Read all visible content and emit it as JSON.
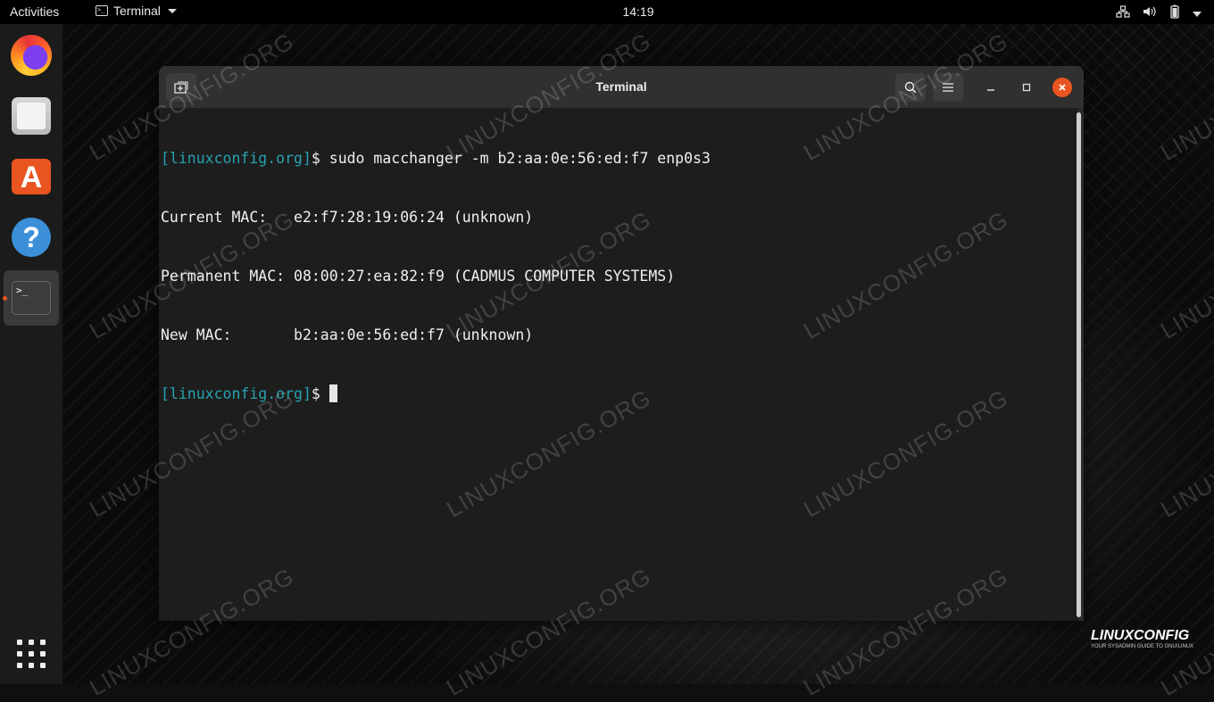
{
  "topbar": {
    "activities": "Activities",
    "app_name": "Terminal",
    "clock": "14:19"
  },
  "dock": {
    "items": [
      "firefox",
      "files",
      "software",
      "help",
      "terminal"
    ]
  },
  "window": {
    "title": "Terminal"
  },
  "terminal": {
    "lines": [
      {
        "prompt": "[linuxconfig.org]",
        "text": "$ sudo macchanger -m b2:aa:0e:56:ed:f7 enp0s3"
      },
      {
        "prompt": "",
        "text": "Current MAC:   e2:f7:28:19:06:24 (unknown)"
      },
      {
        "prompt": "",
        "text": "Permanent MAC: 08:00:27:ea:82:f9 (CADMUS COMPUTER SYSTEMS)"
      },
      {
        "prompt": "",
        "text": "New MAC:       b2:aa:0e:56:ed:f7 (unknown)"
      },
      {
        "prompt": "[linuxconfig.org]",
        "text": "$ "
      }
    ]
  },
  "watermark": "LINUXCONFIG.ORG",
  "logo": {
    "name": "LINUXCONFIG",
    "tagline": "YOUR SYSADMIN GUIDE TO GNU/LINUX"
  },
  "colors": {
    "prompt": "#26a2b0",
    "accent": "#e95420"
  }
}
